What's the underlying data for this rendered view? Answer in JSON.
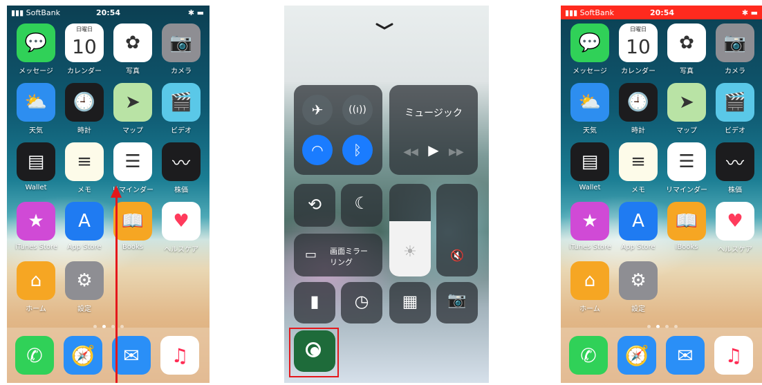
{
  "status": {
    "carrier": "SoftBank",
    "time": "20:54",
    "battery": "✱ ▬"
  },
  "home": {
    "apps": [
      {
        "label": "メッセージ",
        "icon": "messages-icon",
        "bg": "#30d158",
        "glyph": "💬"
      },
      {
        "label": "カレンダー",
        "icon": "calendar-icon",
        "bg": "#ffffff",
        "glyph": "10",
        "day": "日曜日"
      },
      {
        "label": "写真",
        "icon": "photos-icon",
        "bg": "#ffffff",
        "glyph": "✿"
      },
      {
        "label": "カメラ",
        "icon": "camera-icon",
        "bg": "#8e8e93",
        "glyph": "📷"
      },
      {
        "label": "天気",
        "icon": "weather-icon",
        "bg": "#2d8ef0",
        "glyph": "⛅"
      },
      {
        "label": "時計",
        "icon": "clock-icon",
        "bg": "#1c1c1e",
        "glyph": "🕘"
      },
      {
        "label": "マップ",
        "icon": "maps-icon",
        "bg": "#b9e3a5",
        "glyph": "➤"
      },
      {
        "label": "ビデオ",
        "icon": "videos-icon",
        "bg": "#5ac8e8",
        "glyph": "🎬"
      },
      {
        "label": "Wallet",
        "icon": "wallet-icon",
        "bg": "#1c1c1e",
        "glyph": "▤"
      },
      {
        "label": "メモ",
        "icon": "notes-icon",
        "bg": "#fdfbe9",
        "glyph": "≡"
      },
      {
        "label": "リマインダー",
        "icon": "reminders-icon",
        "bg": "#ffffff",
        "glyph": "☰"
      },
      {
        "label": "株価",
        "icon": "stocks-icon",
        "bg": "#1c1c1e",
        "glyph": "〰"
      },
      {
        "label": "iTunes Store",
        "icon": "itunes-store-icon",
        "bg": "#d04ad6",
        "glyph": "★"
      },
      {
        "label": "App Store",
        "icon": "app-store-icon",
        "bg": "#1f7bf2",
        "glyph": "A"
      },
      {
        "label": "iBooks",
        "icon": "ibooks-icon",
        "bg": "#f6a623",
        "glyph": "📖"
      },
      {
        "label": "ヘルスケア",
        "icon": "health-icon",
        "bg": "#ffffff",
        "glyph": "♥"
      },
      {
        "label": "ホーム",
        "icon": "home-app-icon",
        "bg": "#f6a623",
        "glyph": "⌂"
      },
      {
        "label": "設定",
        "icon": "settings-icon",
        "bg": "#8e8e93",
        "glyph": "⚙"
      }
    ],
    "dock": [
      {
        "icon": "phone-icon",
        "bg": "#30d158",
        "glyph": "✆"
      },
      {
        "icon": "safari-icon",
        "bg": "#2a8ff7",
        "glyph": "🧭"
      },
      {
        "icon": "mail-icon",
        "bg": "#2a8ff7",
        "glyph": "✉"
      },
      {
        "icon": "music-icon",
        "bg": "#ffffff",
        "glyph": "♫"
      }
    ],
    "books_label_left": "Books"
  },
  "control_center": {
    "music_title": "ミュージック",
    "screen_mirroring": "画面ミラー\nリング"
  },
  "colors": {
    "arrow": "#e4171b",
    "status_red": "#ff2a1e",
    "toggle_blue": "#1a7cff"
  }
}
